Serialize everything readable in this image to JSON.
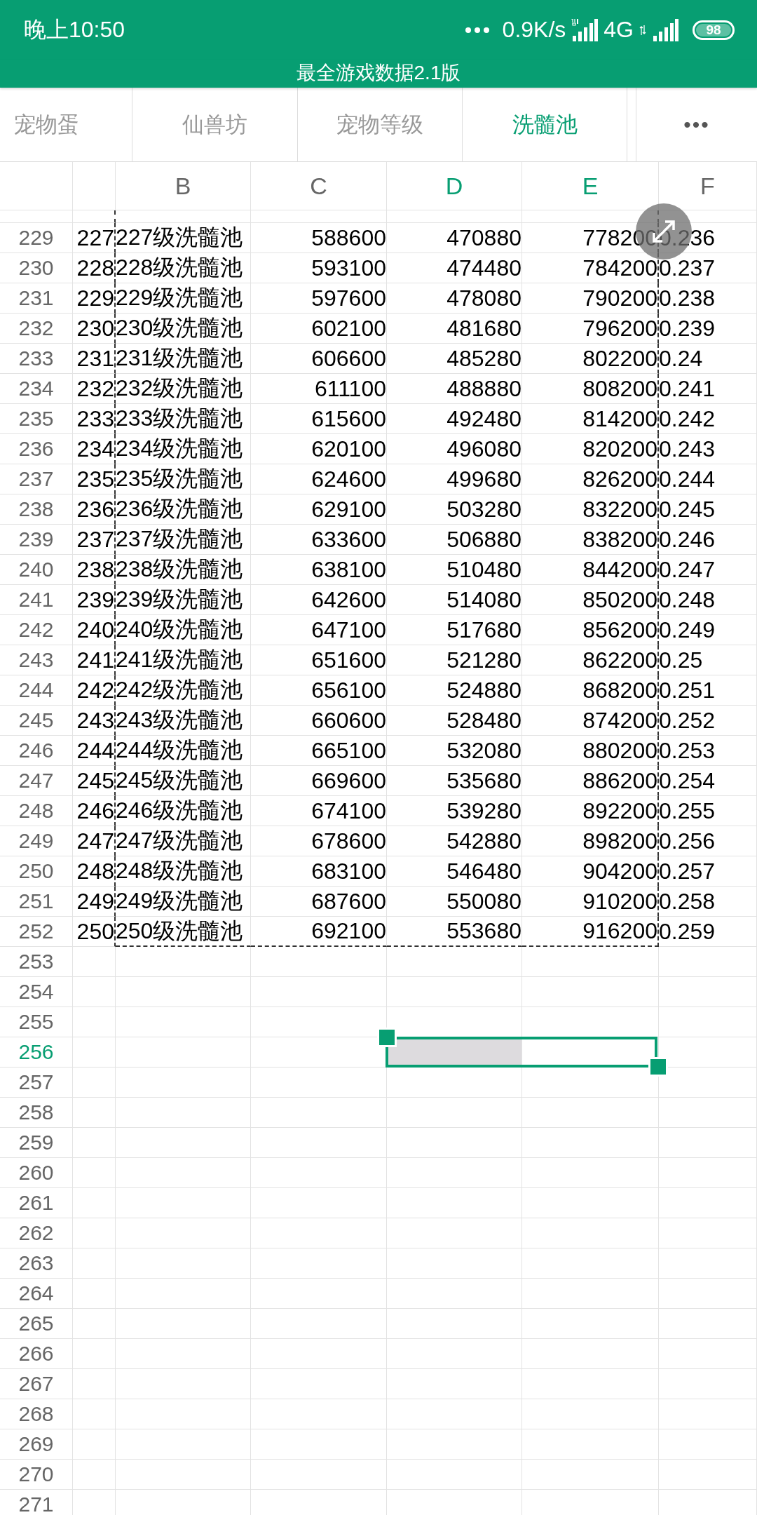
{
  "status_bar": {
    "time": "晚上10:50",
    "speed": "0.9K/s",
    "network": "4G",
    "battery": "98"
  },
  "title": "最全游戏数据2.1版",
  "tabs": [
    {
      "label": "宠物蛋",
      "selected": false
    },
    {
      "label": "仙兽坊",
      "selected": false
    },
    {
      "label": "宠物等级",
      "selected": false
    },
    {
      "label": "洗髓池",
      "selected": true
    }
  ],
  "more_button": "•••",
  "sheet": {
    "columns": [
      {
        "label": "B",
        "selected": false
      },
      {
        "label": "C",
        "selected": false
      },
      {
        "label": "D",
        "selected": true
      },
      {
        "label": "E",
        "selected": true
      },
      {
        "label": "F",
        "selected": false
      }
    ],
    "rows": [
      {
        "label": "229",
        "selected": false,
        "cells": [
          "227",
          "227级洗髓池",
          "588600",
          "470880",
          "778200",
          "0.236"
        ]
      },
      {
        "label": "230",
        "selected": false,
        "cells": [
          "228",
          "228级洗髓池",
          "593100",
          "474480",
          "784200",
          "0.237"
        ]
      },
      {
        "label": "231",
        "selected": false,
        "cells": [
          "229",
          "229级洗髓池",
          "597600",
          "478080",
          "790200",
          "0.238"
        ]
      },
      {
        "label": "232",
        "selected": false,
        "cells": [
          "230",
          "230级洗髓池",
          "602100",
          "481680",
          "796200",
          "0.239"
        ]
      },
      {
        "label": "233",
        "selected": false,
        "cells": [
          "231",
          "231级洗髓池",
          "606600",
          "485280",
          "802200",
          "0.24"
        ]
      },
      {
        "label": "234",
        "selected": false,
        "cells": [
          "232",
          "232级洗髓池",
          "611100",
          "488880",
          "808200",
          "0.241"
        ]
      },
      {
        "label": "235",
        "selected": false,
        "cells": [
          "233",
          "233级洗髓池",
          "615600",
          "492480",
          "814200",
          "0.242"
        ]
      },
      {
        "label": "236",
        "selected": false,
        "cells": [
          "234",
          "234级洗髓池",
          "620100",
          "496080",
          "820200",
          "0.243"
        ]
      },
      {
        "label": "237",
        "selected": false,
        "cells": [
          "235",
          "235级洗髓池",
          "624600",
          "499680",
          "826200",
          "0.244"
        ]
      },
      {
        "label": "238",
        "selected": false,
        "cells": [
          "236",
          "236级洗髓池",
          "629100",
          "503280",
          "832200",
          "0.245"
        ]
      },
      {
        "label": "239",
        "selected": false,
        "cells": [
          "237",
          "237级洗髓池",
          "633600",
          "506880",
          "838200",
          "0.246"
        ]
      },
      {
        "label": "240",
        "selected": false,
        "cells": [
          "238",
          "238级洗髓池",
          "638100",
          "510480",
          "844200",
          "0.247"
        ]
      },
      {
        "label": "241",
        "selected": false,
        "cells": [
          "239",
          "239级洗髓池",
          "642600",
          "514080",
          "850200",
          "0.248"
        ]
      },
      {
        "label": "242",
        "selected": false,
        "cells": [
          "240",
          "240级洗髓池",
          "647100",
          "517680",
          "856200",
          "0.249"
        ]
      },
      {
        "label": "243",
        "selected": false,
        "cells": [
          "241",
          "241级洗髓池",
          "651600",
          "521280",
          "862200",
          "0.25"
        ]
      },
      {
        "label": "244",
        "selected": false,
        "cells": [
          "242",
          "242级洗髓池",
          "656100",
          "524880",
          "868200",
          "0.251"
        ]
      },
      {
        "label": "245",
        "selected": false,
        "cells": [
          "243",
          "243级洗髓池",
          "660600",
          "528480",
          "874200",
          "0.252"
        ]
      },
      {
        "label": "246",
        "selected": false,
        "cells": [
          "244",
          "244级洗髓池",
          "665100",
          "532080",
          "880200",
          "0.253"
        ]
      },
      {
        "label": "247",
        "selected": false,
        "cells": [
          "245",
          "245级洗髓池",
          "669600",
          "535680",
          "886200",
          "0.254"
        ]
      },
      {
        "label": "248",
        "selected": false,
        "cells": [
          "246",
          "246级洗髓池",
          "674100",
          "539280",
          "892200",
          "0.255"
        ]
      },
      {
        "label": "249",
        "selected": false,
        "cells": [
          "247",
          "247级洗髓池",
          "678600",
          "542880",
          "898200",
          "0.256"
        ]
      },
      {
        "label": "250",
        "selected": false,
        "cells": [
          "248",
          "248级洗髓池",
          "683100",
          "546480",
          "904200",
          "0.257"
        ]
      },
      {
        "label": "251",
        "selected": false,
        "cells": [
          "249",
          "249级洗髓池",
          "687600",
          "550080",
          "910200",
          "0.258"
        ]
      },
      {
        "label": "252",
        "selected": false,
        "cells": [
          "250",
          "250级洗髓池",
          "692100",
          "553680",
          "916200",
          "0.259"
        ]
      },
      {
        "label": "253",
        "selected": false
      },
      {
        "label": "254",
        "selected": false
      },
      {
        "label": "255",
        "selected": false
      },
      {
        "label": "256",
        "selected": true
      },
      {
        "label": "257",
        "selected": false
      },
      {
        "label": "258",
        "selected": false
      },
      {
        "label": "259",
        "selected": false
      },
      {
        "label": "260",
        "selected": false
      },
      {
        "label": "261",
        "selected": false
      },
      {
        "label": "262",
        "selected": false
      },
      {
        "label": "263",
        "selected": false
      },
      {
        "label": "264",
        "selected": false
      },
      {
        "label": "265",
        "selected": false
      },
      {
        "label": "266",
        "selected": false
      },
      {
        "label": "267",
        "selected": false
      },
      {
        "label": "268",
        "selected": false
      },
      {
        "label": "269",
        "selected": false
      },
      {
        "label": "270",
        "selected": false
      },
      {
        "label": "271",
        "selected": false
      }
    ]
  }
}
